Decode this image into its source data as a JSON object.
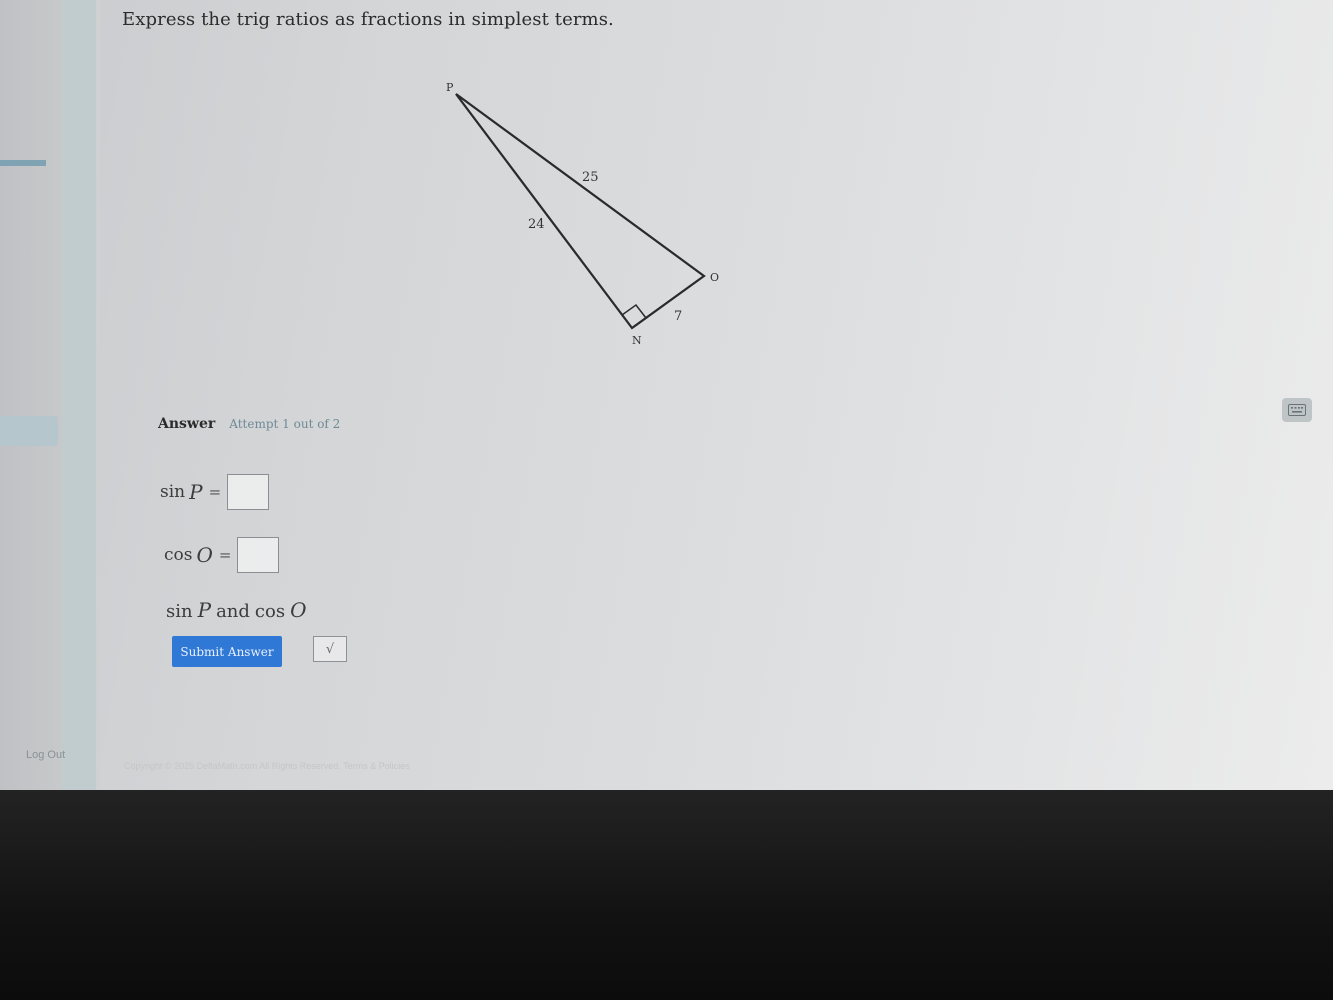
{
  "question": {
    "text": "Express the trig ratios as fractions in simplest terms."
  },
  "diagram": {
    "vertices": {
      "p": "P",
      "o": "O",
      "n": "N"
    },
    "sides": {
      "pn": "24",
      "po": "25",
      "no": "7"
    }
  },
  "answer": {
    "label": "Answer",
    "attempt": "Attempt 1 out of 2",
    "sin_fn": "sin",
    "sin_var": "P",
    "cos_fn": "cos",
    "cos_var": "O",
    "equals": "=",
    "relation": {
      "fn1": "sin",
      "var1": "P",
      "and": "and",
      "fn2": "cos",
      "var2": "O"
    }
  },
  "buttons": {
    "submit": "Submit Answer",
    "sqrt": "√"
  },
  "sidebar": {
    "logout": "Log Out"
  },
  "footer": {
    "copyright": "Copyright © 2025 DeltaMath.com All Rights Reserved. Terms & Policies"
  },
  "colors": {
    "submit_button": "#2f78d6",
    "attempt_text": "#6f8a96"
  },
  "icons": {
    "keyboard": "keyboard-icon",
    "right_angle": "right-angle-marker"
  }
}
